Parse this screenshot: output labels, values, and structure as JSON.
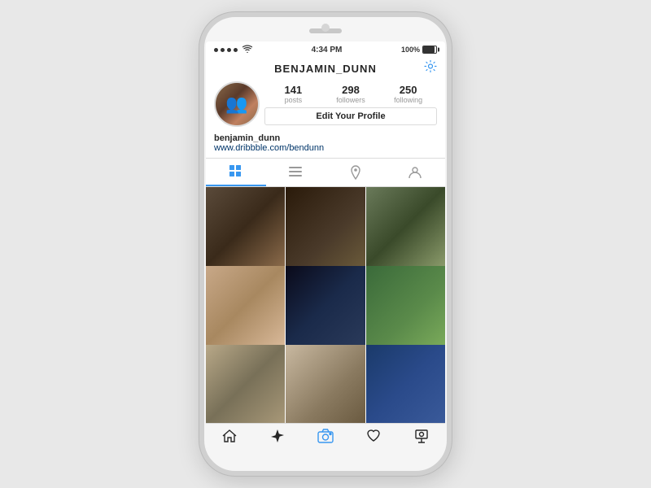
{
  "phone": {
    "status_bar": {
      "time": "4:34 PM",
      "battery": "100%"
    },
    "header": {
      "username": "BENJAMIN_DUNN",
      "settings_icon": "gear-icon"
    },
    "stats": {
      "posts_count": "141",
      "posts_label": "posts",
      "followers_count": "298",
      "followers_label": "followers",
      "following_count": "250",
      "following_label": "following"
    },
    "edit_button_label": "Edit Your Profile",
    "bio": {
      "name": "benjamin_dunn",
      "link": "www.dribbble.com/bendunn"
    },
    "tabs": [
      {
        "id": "grid",
        "label": "grid-icon",
        "active": true
      },
      {
        "id": "list",
        "label": "list-icon",
        "active": false
      },
      {
        "id": "location",
        "label": "location-icon",
        "active": false
      },
      {
        "id": "person",
        "label": "person-icon",
        "active": false
      }
    ],
    "photos": [
      {
        "id": 1,
        "class": "p1"
      },
      {
        "id": 2,
        "class": "p2"
      },
      {
        "id": 3,
        "class": "p3"
      },
      {
        "id": 4,
        "class": "p4"
      },
      {
        "id": 5,
        "class": "p5"
      },
      {
        "id": 6,
        "class": "p6"
      },
      {
        "id": 7,
        "class": "p7"
      },
      {
        "id": 8,
        "class": "p8"
      },
      {
        "id": 9,
        "class": "p9"
      }
    ],
    "bottom_nav": [
      {
        "id": "home",
        "icon": "home-icon"
      },
      {
        "id": "explore",
        "icon": "star-icon"
      },
      {
        "id": "camera",
        "icon": "camera-icon",
        "active": true
      },
      {
        "id": "heart",
        "icon": "heart-icon"
      },
      {
        "id": "profile",
        "icon": "profile-icon"
      }
    ]
  }
}
